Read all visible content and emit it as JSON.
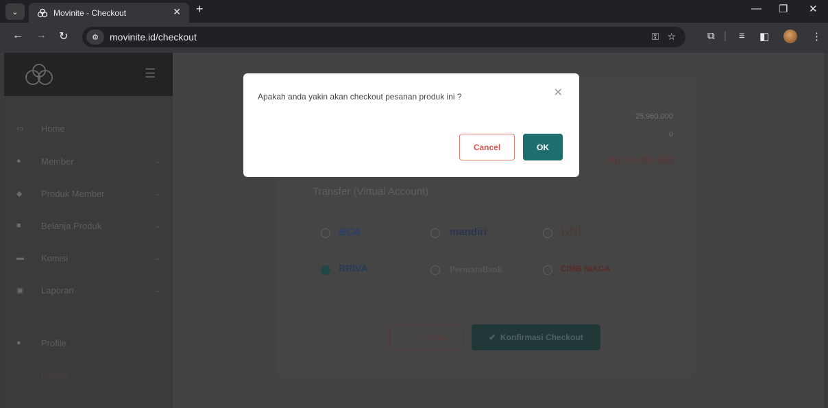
{
  "browser": {
    "tab_title": "Movinite - Checkout",
    "url": "movinite.id/checkout",
    "icons": [
      "tab-menu-icon",
      "close-icon",
      "new-tab-icon",
      "minimize-icon",
      "restore-icon",
      "back-icon",
      "forward-icon",
      "reload-icon",
      "site-info-icon",
      "key-icon",
      "star-icon",
      "extensions-icon",
      "media-icon",
      "sidebar-icon",
      "profile-avatar",
      "menu-dots-icon"
    ]
  },
  "sidebar": {
    "items": [
      {
        "label": "Home",
        "icon": "monitor-icon",
        "has_chevron": false
      },
      {
        "label": "Member",
        "icon": "user-icon",
        "has_chevron": true
      },
      {
        "label": "Produk Member",
        "icon": "tag-icon",
        "has_chevron": true
      },
      {
        "label": "Belanja Produk",
        "icon": "bag-icon",
        "has_chevron": true
      },
      {
        "label": "Komisi",
        "icon": "card-icon",
        "has_chevron": true
      },
      {
        "label": "Laporan",
        "icon": "report-icon",
        "has_chevron": true
      },
      {
        "label": "Profile",
        "icon": "user-icon",
        "has_chevron": false
      },
      {
        "label": "Logout",
        "icon": "power-icon",
        "has_chevron": false
      }
    ]
  },
  "checkout": {
    "subtotal": "25.960.000",
    "discount": "0",
    "total": "Rp 25.960.000",
    "payment_section": "Transfer (Virtual Account)",
    "banks": [
      {
        "label": "BCA",
        "selected": false,
        "color": "#2a3f6a"
      },
      {
        "label": "mandiri",
        "selected": false,
        "color": "#2a3550"
      },
      {
        "label": "BNI",
        "selected": false,
        "color": "#4a3a34"
      },
      {
        "label": "BRIVA",
        "selected": true,
        "color": "#2a3a5a"
      },
      {
        "label": "PermataBank",
        "selected": false,
        "color": "#555555"
      },
      {
        "label": "CIMB NIAGA",
        "selected": false,
        "color": "#5a2a2a"
      }
    ],
    "back_label": "Kembali",
    "confirm_label": "Konfirmasi Checkout"
  },
  "dialog": {
    "message": "Apakah anda yakin akan checkout pesanan produk ini ?",
    "cancel_label": "Cancel",
    "ok_label": "OK"
  },
  "colors": {
    "accent": "#1f6e6e",
    "danger": "#d9534f",
    "overlay": "#3a3a3a"
  }
}
